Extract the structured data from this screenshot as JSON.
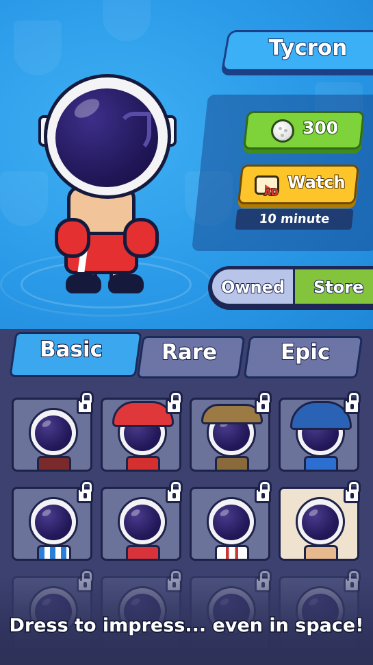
{
  "player": {
    "name": "Tycron"
  },
  "currency": {
    "coins": "300"
  },
  "ad_offer": {
    "watch_label": "Watch",
    "ad_tag": "AD",
    "timer_text": "10 minute"
  },
  "store_toggle": {
    "owned_label": "Owned",
    "store_label": "Store",
    "active": "Store"
  },
  "tabs": [
    {
      "label": "Basic",
      "active": true
    },
    {
      "label": "Rare",
      "active": false
    },
    {
      "label": "Epic",
      "active": false
    }
  ],
  "skins": [
    {
      "name": "suit",
      "locked": true,
      "selected": false
    },
    {
      "name": "firefighter",
      "locked": true,
      "selected": false
    },
    {
      "name": "police",
      "locked": true,
      "selected": false
    },
    {
      "name": "cricket",
      "locked": true,
      "selected": false
    },
    {
      "name": "football-stripes",
      "locked": true,
      "selected": false
    },
    {
      "name": "red-jersey",
      "locked": true,
      "selected": false
    },
    {
      "name": "suspenders",
      "locked": true,
      "selected": false
    },
    {
      "name": "boxer",
      "locked": true,
      "selected": true
    }
  ],
  "caption": "Dress to impress... even in space!",
  "colors": {
    "sky_blue": "#2a9ae8",
    "coin_button": "#7ed23a",
    "watch_button": "#fec52b",
    "tab_active": "#3aa7ef",
    "tab_inactive": "#6c75a6",
    "store_active": "#84c43c",
    "grid_bg": "#3c4170"
  }
}
